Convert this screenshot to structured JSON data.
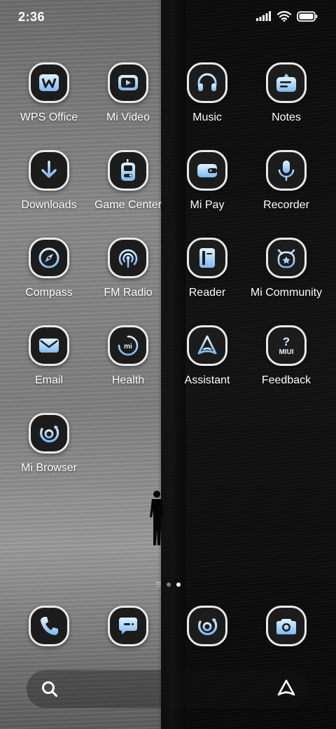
{
  "status_bar": {
    "time": "2:36"
  },
  "apps": [
    {
      "label": "WPS Office",
      "icon": "wps-office-icon"
    },
    {
      "label": "Mi Video",
      "icon": "video-play-icon"
    },
    {
      "label": "Music",
      "icon": "headphones-icon"
    },
    {
      "label": "Notes",
      "icon": "notes-icon"
    },
    {
      "label": "Downloads",
      "icon": "download-arrow-icon"
    },
    {
      "label": "Game Center",
      "icon": "game-controller-icon"
    },
    {
      "label": "Mi Pay",
      "icon": "wallet-icon"
    },
    {
      "label": "Recorder",
      "icon": "microphone-icon"
    },
    {
      "label": "Compass",
      "icon": "compass-icon"
    },
    {
      "label": "FM Radio",
      "icon": "radio-broadcast-icon"
    },
    {
      "label": "Reader",
      "icon": "book-icon"
    },
    {
      "label": "Mi Community",
      "icon": "mi-bunny-icon"
    },
    {
      "label": "Email",
      "icon": "envelope-icon"
    },
    {
      "label": "Health",
      "icon": "health-ring-icon"
    },
    {
      "label": "Assistant",
      "icon": "assistant-a-icon"
    },
    {
      "label": "Feedback",
      "icon": "feedback-miui-icon",
      "icon_text": "MIUI"
    },
    {
      "label": "Mi Browser",
      "icon": "browser-orbit-icon"
    }
  ],
  "health_icon_text": "mi",
  "dock": [
    {
      "name": "phone",
      "icon": "phone-icon"
    },
    {
      "name": "messages",
      "icon": "message-bubble-icon"
    },
    {
      "name": "browser",
      "icon": "browser-orbit-icon"
    },
    {
      "name": "camera",
      "icon": "camera-icon"
    }
  ],
  "pages": {
    "count": 2,
    "active": 2
  },
  "colors": {
    "icon_accent": "#bfe3ff",
    "icon_accent_deep": "#7db8f0",
    "icon_bg": "#1c1c1c",
    "icon_border": "#e9e9e9"
  }
}
